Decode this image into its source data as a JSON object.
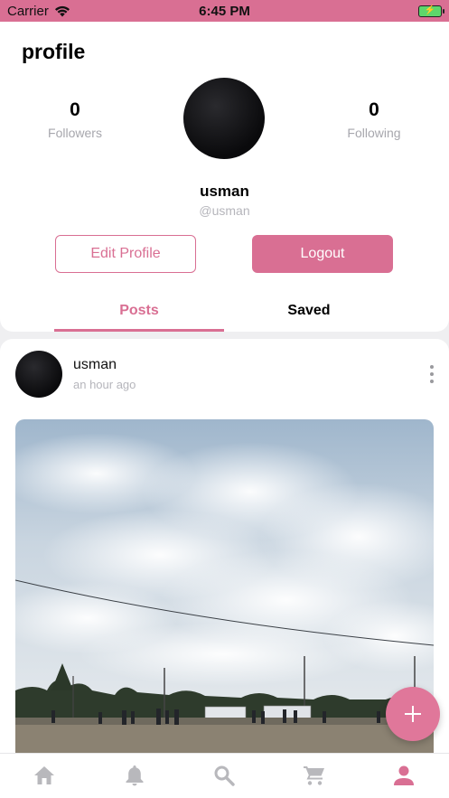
{
  "status_bar": {
    "carrier": "Carrier",
    "time": "6:45 PM",
    "icons": [
      "wifi-icon",
      "battery-charging-icon"
    ]
  },
  "header": {
    "title": "profile"
  },
  "profile": {
    "followers": {
      "count": "0",
      "label": "Followers"
    },
    "following": {
      "count": "0",
      "label": "Following"
    },
    "name": "usman",
    "handle": "@usman"
  },
  "actions": {
    "edit_label": "Edit Profile",
    "logout_label": "Logout"
  },
  "tabs": [
    {
      "label": "Posts",
      "active": true
    },
    {
      "label": "Saved",
      "active": false
    }
  ],
  "post": {
    "author": "usman",
    "time": "an hour ago",
    "image": "sky-field-photo"
  },
  "fab": {
    "icon": "plus-icon"
  },
  "bottom_nav": {
    "items": [
      {
        "icon": "home-icon",
        "active": false
      },
      {
        "icon": "bell-icon",
        "active": false
      },
      {
        "icon": "search-icon",
        "active": false
      },
      {
        "icon": "cart-icon",
        "active": false
      },
      {
        "icon": "person-icon",
        "active": true
      }
    ]
  },
  "colors": {
    "accent": "#d96f93",
    "fab": "#e0779a",
    "nav_inactive": "#b8b8bc",
    "muted_text": "#a7a7ad"
  }
}
